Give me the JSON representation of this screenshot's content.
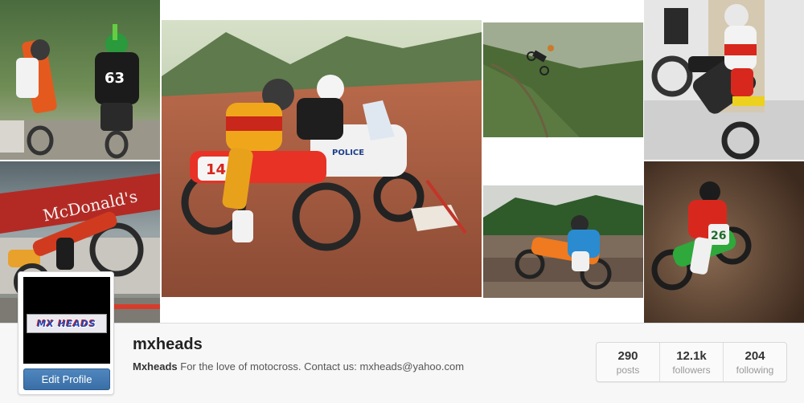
{
  "profile": {
    "username": "mxheads",
    "full_name": "Mxheads",
    "bio": "For the love of motocross. Contact us: mxheads@yahoo.com",
    "avatar_logo_text": "MX HEADS",
    "edit_profile_label": "Edit Profile"
  },
  "stats": [
    {
      "value": "290",
      "label": "posts"
    },
    {
      "value": "12.1k",
      "label": "followers"
    },
    {
      "value": "204",
      "label": "following"
    }
  ],
  "photos": [
    {
      "name": "photo-riders-wheelie",
      "description": "two motocross riders doing wheelies"
    },
    {
      "name": "photo-mcdonalds-wheelie",
      "description": "rider wheelie in front of restaurant"
    },
    {
      "name": "photo-police-bike",
      "description": "motocross rider next to police motorcycle"
    },
    {
      "name": "photo-hill-jump",
      "description": "rider jumping over grassy hill"
    },
    {
      "name": "photo-garage-stoppie",
      "description": "rider doing stoppie in garage"
    },
    {
      "name": "photo-track-ride",
      "description": "rider on muddy track"
    },
    {
      "name": "photo-dirt-corner",
      "description": "rider cornering in dirt"
    }
  ]
}
